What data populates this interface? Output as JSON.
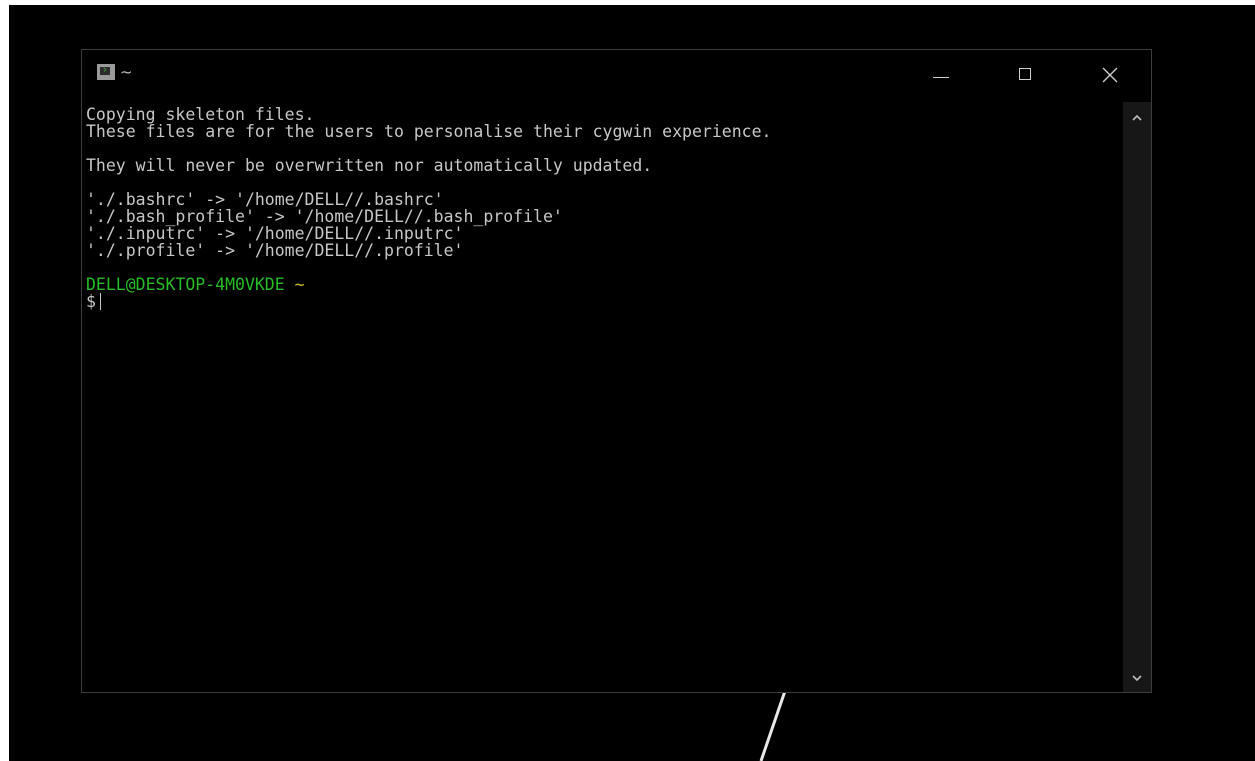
{
  "window": {
    "title": "~",
    "icon": "terminal-icon",
    "controls": {
      "minimize_icon": "minimize-icon",
      "maximize_icon": "maximize-icon",
      "close_icon": "close-icon"
    }
  },
  "terminal": {
    "lines": [
      "Copying skeleton files.",
      "These files are for the users to personalise their cygwin experience.",
      "",
      "They will never be overwritten nor automatically updated.",
      "",
      "'./.bashrc' -> '/home/DELL//.bashrc'",
      "'./.bash_profile' -> '/home/DELL//.bash_profile'",
      "'./.inputrc' -> '/home/DELL//.inputrc'",
      "'./.profile' -> '/home/DELL//.profile'",
      ""
    ],
    "prompt_host": "DELL@DESKTOP-4M0VKDE",
    "prompt_path": "~",
    "prompt_symbol": "$",
    "colors": {
      "text": "#c7c7c7",
      "host": "#25bc24",
      "path": "#c7bf22",
      "background": "#000000"
    }
  },
  "scrollbar": {
    "up_icon": "chevron-up-icon",
    "down_icon": "chevron-down-icon"
  }
}
